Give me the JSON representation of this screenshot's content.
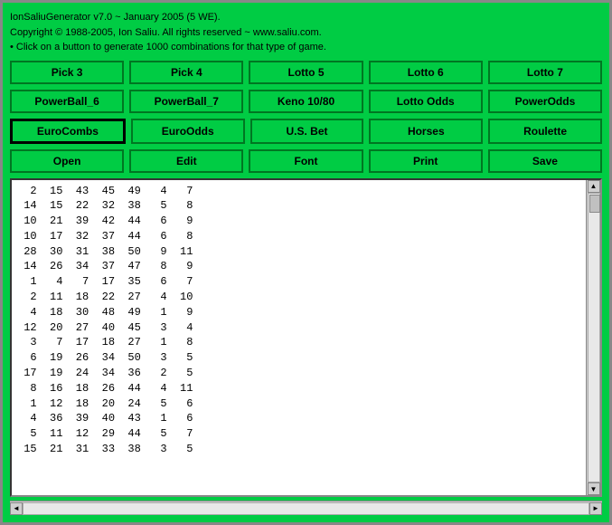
{
  "header": {
    "line1": "IonSaliuGenerator v7.0 ~ January 2005 (5 WE).",
    "line2": "Copyright © 1988-2005, Ion Saliu. All rights reserved ~ www.saliu.com.",
    "line3": "• Click on a button to generate 1000 combinations for that type of game."
  },
  "buttons": {
    "row1": [
      {
        "label": "Pick 3",
        "name": "pick3-button"
      },
      {
        "label": "Pick 4",
        "name": "pick4-button"
      },
      {
        "label": "Lotto 5",
        "name": "lotto5-button"
      },
      {
        "label": "Lotto 6",
        "name": "lotto6-button"
      },
      {
        "label": "Lotto 7",
        "name": "lotto7-button"
      }
    ],
    "row2": [
      {
        "label": "PowerBall_6",
        "name": "powerball6-button"
      },
      {
        "label": "PowerBall_7",
        "name": "powerball7-button"
      },
      {
        "label": "Keno 10/80",
        "name": "keno-button"
      },
      {
        "label": "Lotto Odds",
        "name": "lotto-odds-button"
      },
      {
        "label": "PowerOdds",
        "name": "powerodds-button"
      }
    ],
    "row3": [
      {
        "label": "EuroCombs",
        "name": "eurocombs-button",
        "selected": true
      },
      {
        "label": "EuroOdds",
        "name": "euroOdds-button"
      },
      {
        "label": "U.S. Bet",
        "name": "usbet-button"
      },
      {
        "label": "Horses",
        "name": "horses-button"
      },
      {
        "label": "Roulette",
        "name": "roulette-button"
      }
    ],
    "row4": [
      {
        "label": "Open",
        "name": "open-button"
      },
      {
        "label": "Edit",
        "name": "edit-button"
      },
      {
        "label": "Font",
        "name": "font-button"
      },
      {
        "label": "Print",
        "name": "print-button"
      },
      {
        "label": "Save",
        "name": "save-button"
      }
    ]
  },
  "output": {
    "lines": [
      "  2  15  43  45  49   4   7",
      " 14  15  22  32  38   5   8",
      " 10  21  39  42  44   6   9",
      " 10  17  32  37  44   6   8",
      " 28  30  31  38  50   9  11",
      " 14  26  34  37  47   8   9",
      "  1   4   7  17  35   6   7",
      "  2  11  18  22  27   4  10",
      "  4  18  30  48  49   1   9",
      " 12  20  27  40  45   3   4",
      "  3   7  17  18  27   1   8",
      "  6  19  26  34  50   3   5",
      " 17  19  24  34  36   2   5",
      "  8  16  18  26  44   4  11",
      "  1  12  18  20  24   5   6",
      "  4  36  39  40  43   1   6",
      "  5  11  12  29  44   5   7",
      " 15  21  31  33  38   3   5"
    ]
  }
}
